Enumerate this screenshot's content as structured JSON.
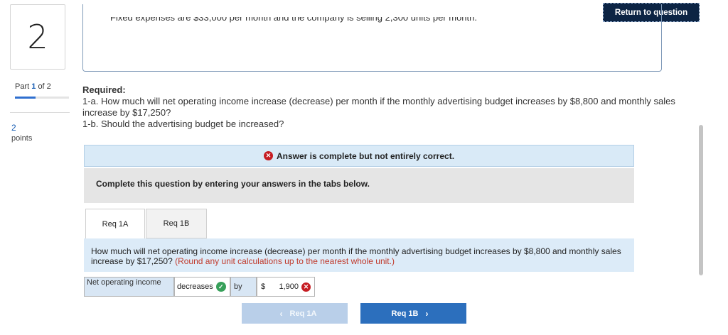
{
  "question": {
    "number": "2"
  },
  "part": {
    "prefix": "Part",
    "current": "1",
    "of_text": "of 2",
    "progress": 0.5
  },
  "points": {
    "value": "2",
    "label": "points"
  },
  "return_button": "Return to question",
  "previous_text": "Fixed expenses are $33,000 per month and the company is selling 2,300 units per month.",
  "required": {
    "heading": "Required:",
    "line1": "1-a. How much will net operating income increase (decrease) per month if the monthly advertising budget increases by $8,800 and monthly sales increase by $17,250?",
    "line2": "1-b. Should the advertising budget be increased?"
  },
  "banner": {
    "icon": "x-circle-icon",
    "text": "Answer is complete but not entirely correct."
  },
  "instruction": "Complete this question by entering your answers in the tabs below.",
  "tabs": [
    {
      "label": "Req 1A",
      "active": true
    },
    {
      "label": "Req 1B",
      "active": false
    }
  ],
  "question_text": {
    "main": "How much will net operating income increase (decrease) per month if the monthly advertising budget increases by $8,800 and monthly sales increase by $17,250? ",
    "hint": "(Round any unit calculations up to the nearest whole unit.)"
  },
  "answer": {
    "label": "Net operating income",
    "selection": "decreases",
    "selection_status": "correct",
    "by_label": "by",
    "currency": "$",
    "amount": "1,900",
    "amount_status": "incorrect"
  },
  "nav": {
    "prev_label": "Req 1A",
    "next_label": "Req 1B"
  },
  "colors": {
    "primary": "#2c6fbd",
    "dark_navy": "#0c2444",
    "error": "#c61d23",
    "success": "#37a05a"
  }
}
